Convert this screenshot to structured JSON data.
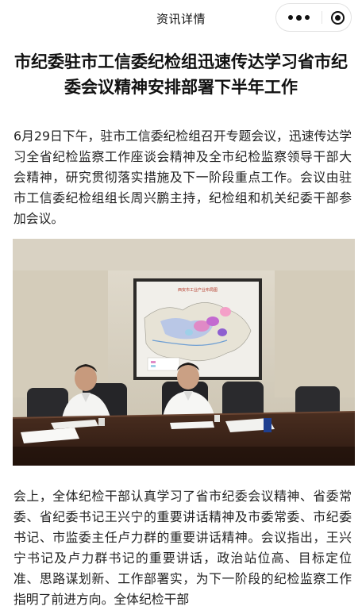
{
  "nav": {
    "title": "资讯详情",
    "more_icon": "more-dots-icon",
    "close_icon": "target-close-icon"
  },
  "article": {
    "title": "市纪委驻市工信委纪检组迅速传达学习省市纪委会议精神安排部署下半年工作",
    "paragraphs": [
      "6月29日下午，驻市工信委纪检组召开专题会议，迅速传达学习全省纪检监察工作座谈会精神及全市纪检监察领导干部大会精神，研究贯彻落实措施及下一阶段重点工作。会议由驻市工信委纪检组组长周兴鹏主持，纪检组和机关纪委干部参加会议。",
      "会上，全体纪检干部认真学习了省市纪委会议精神、省委常委、省纪委书记王兴宁的重要讲话精神及市委常委、市纪委书记、市监委主任卢力群的重要讲话精神。会议指出，王兴宁书记及卢力群书记的重要讲话，政治站位高、目标定位准、思路谋划新、工作部署实，为下一阶段的纪检监察工作指明了前进方向。全体纪检干部"
    ],
    "photo": {
      "map_title": "西安市工业产业布局图"
    }
  }
}
